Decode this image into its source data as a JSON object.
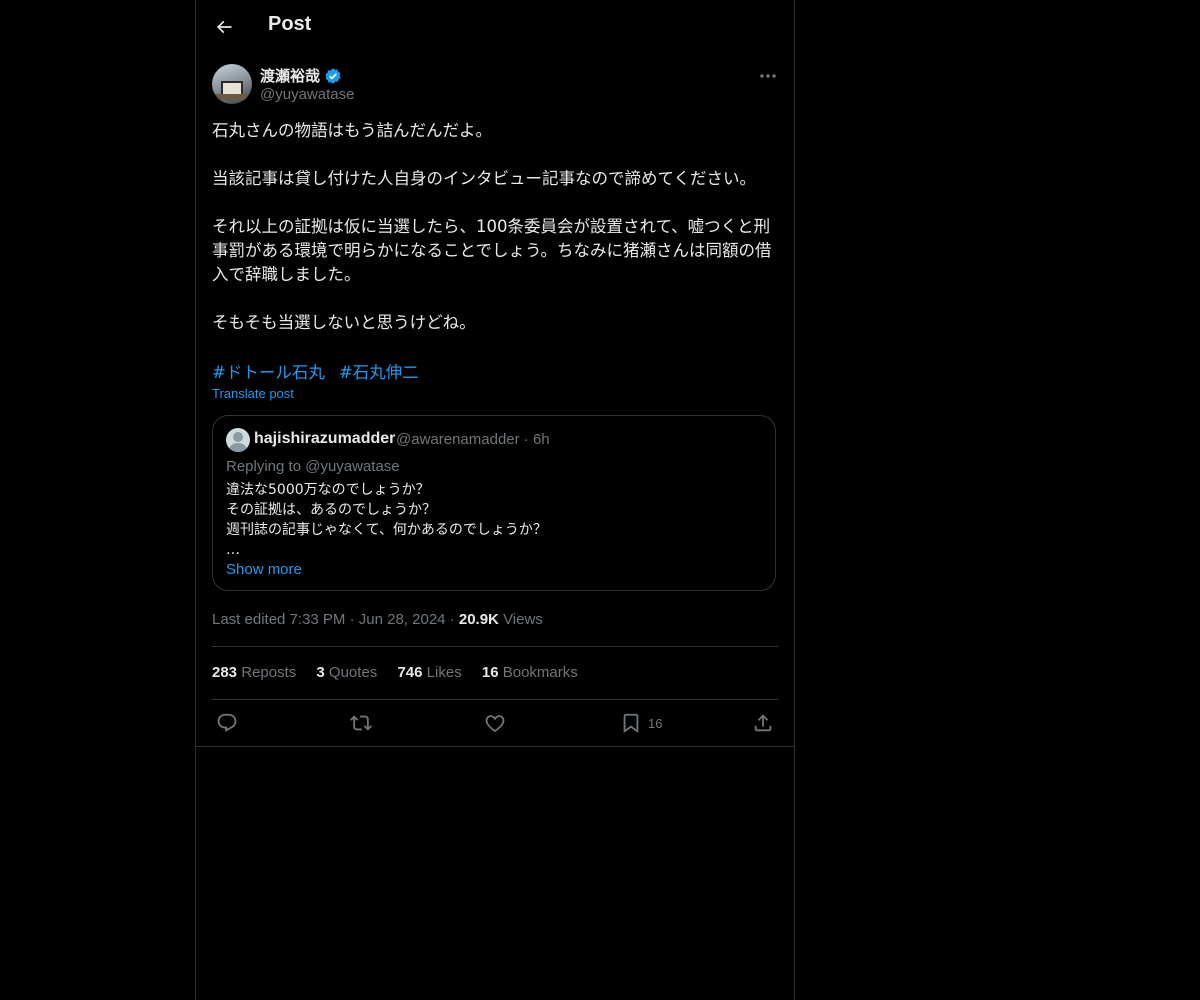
{
  "header": {
    "title": "Post"
  },
  "author": {
    "name": "渡瀬裕哉",
    "handle": "@yuyawatase"
  },
  "post": {
    "text": "石丸さんの物語はもう詰んだんだよ。\n\n当該記事は貸し付けた人自身のインタビュー記事なので諦めてください。\n\nそれ以上の証拠は仮に当選したら、100条委員会が設置されて、嘘つくと刑事罰がある環境で明らかになることでしょう。ちなみに猪瀬さんは同額の借入で辞職しました。\n\nそもそも当選しないと思うけどね。",
    "hashtags": [
      "#ドトール石丸",
      "#石丸伸二"
    ],
    "translate_label": "Translate post"
  },
  "quote": {
    "name": "hajishirazumadder",
    "meta": "@awarenamadder · 6h",
    "replying": "Replying to @yuyawatase",
    "text": "違法な5000万なのでしょうか？\nその証拠は、あるのでしょうか？\n週刊誌の記事じゃなくて、何かあるのでしょうか？\n…",
    "show_more": "Show more"
  },
  "meta": {
    "edited": "Last edited 7:33 PM",
    "date": "Jun 28, 2024",
    "views_count": "20.9K",
    "views_label": "Views"
  },
  "stats": {
    "reposts_count": "283",
    "reposts_label": "Reposts",
    "quotes_count": "3",
    "quotes_label": "Quotes",
    "likes_count": "746",
    "likes_label": "Likes",
    "bookmarks_count": "16",
    "bookmarks_label": "Bookmarks"
  },
  "actions": {
    "bookmark_count": "16"
  },
  "icons": {
    "back": "arrow-left-icon",
    "verified": "verified-badge-icon",
    "more": "more-icon",
    "reply": "reply-icon",
    "repost": "repost-icon",
    "like": "heart-icon",
    "bookmark": "bookmark-icon",
    "share": "share-icon"
  },
  "colors": {
    "accent": "#1d9bf0",
    "muted": "#71767b",
    "background": "#000000",
    "border": "#2f3336"
  }
}
